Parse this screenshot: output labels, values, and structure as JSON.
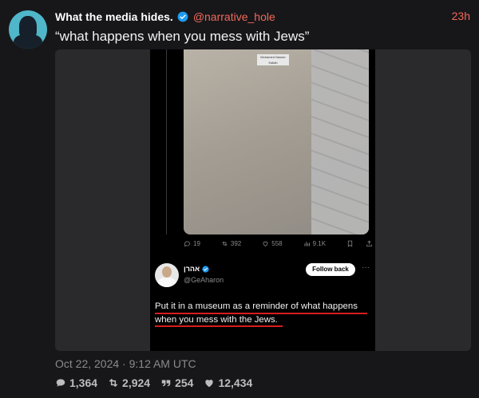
{
  "tweet": {
    "author": "What the media hides.",
    "handle": "@narrative_hole",
    "time": "23h",
    "text": "“what happens when you mess with Jews”",
    "date": "Oct 22, 2024 · 9:12 AM UTC",
    "stats": {
      "replies": "1,364",
      "retweets": "2,924",
      "quotes": "254",
      "likes": "12,434"
    }
  },
  "embedded": {
    "photo_label": "Mohamed Nasser Kallab",
    "actions": {
      "replies": "19",
      "retweets": "392",
      "likes": "558",
      "views": "9.1K"
    },
    "reply": {
      "name": "אהרן",
      "handle": "@GeAharon",
      "follow_label": "Follow back",
      "more": "···",
      "text": "Put it in a museum as a reminder of what happens when you mess with the Jews."
    }
  },
  "colors": {
    "accent": "#f06a5a",
    "verified": "#1d9bf0",
    "underline": "#d81c1c",
    "background": "#17171a"
  }
}
